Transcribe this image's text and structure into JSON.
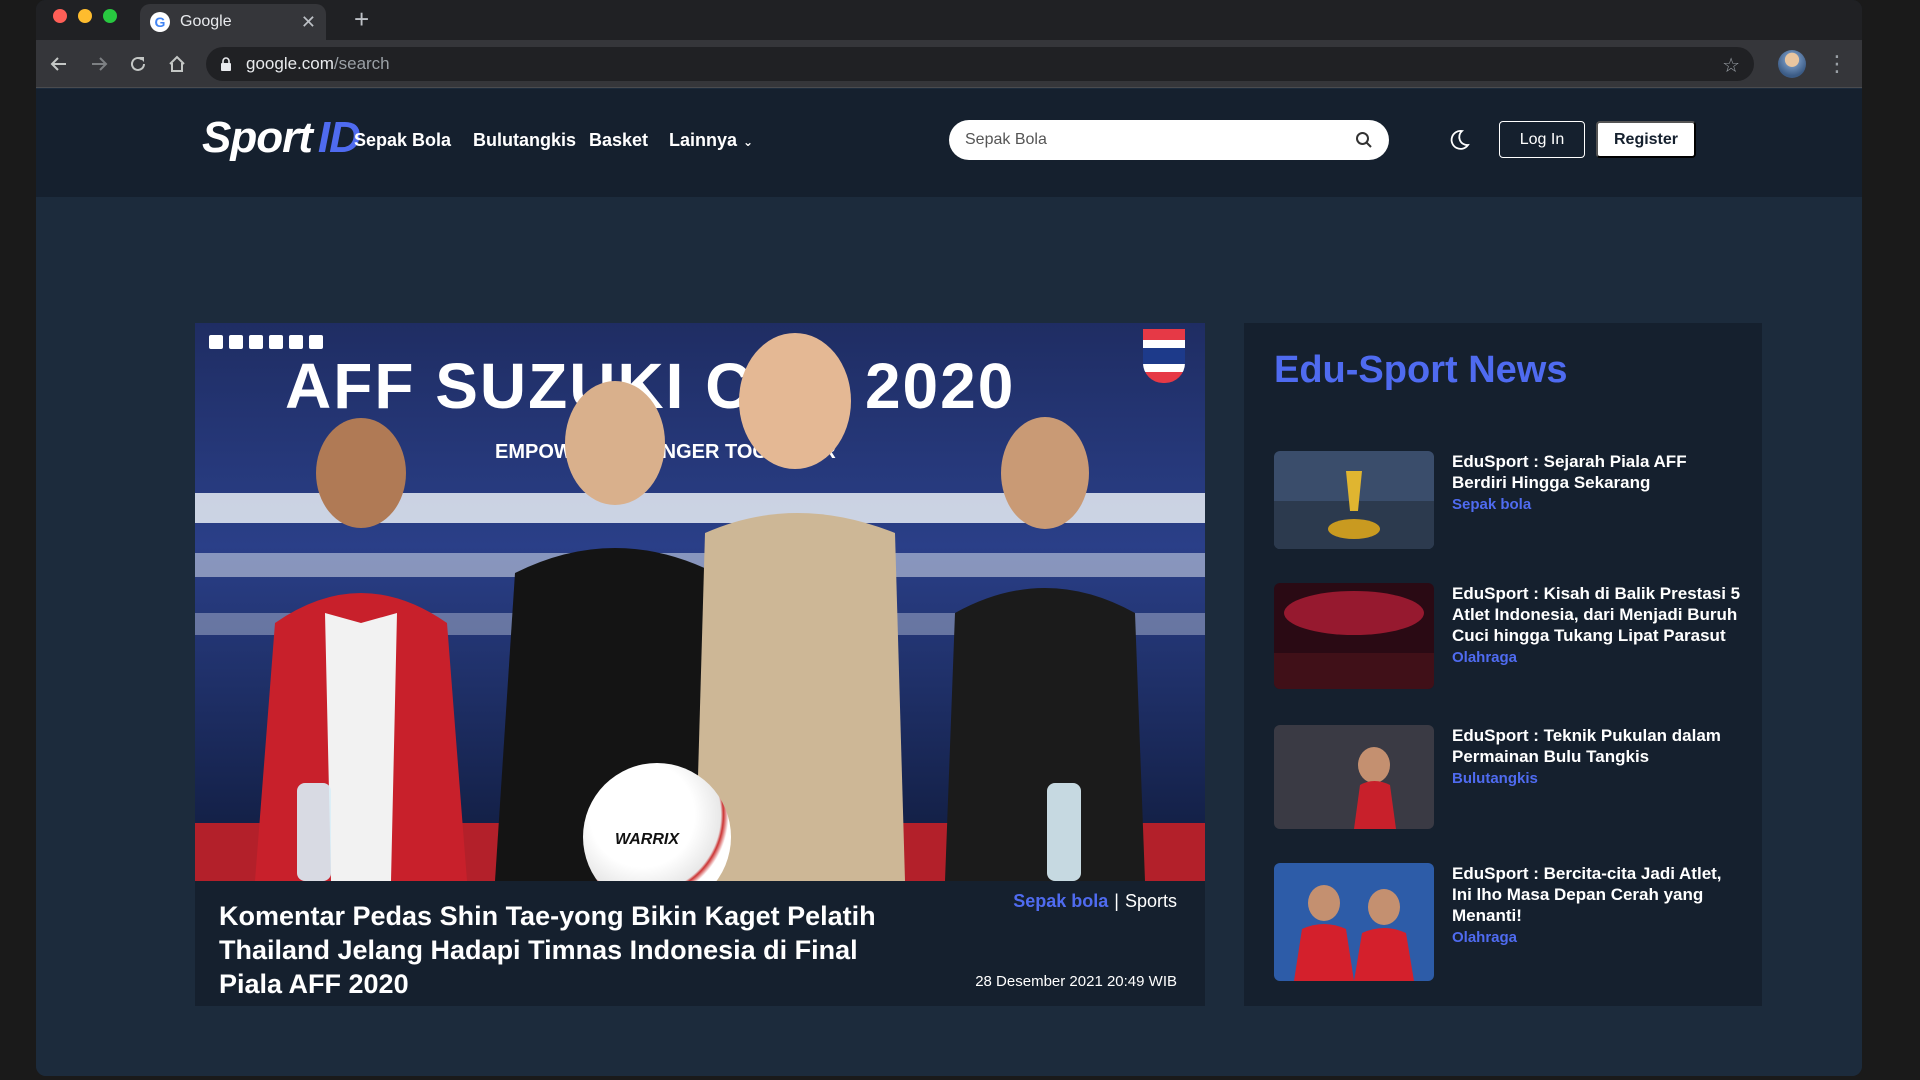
{
  "browser": {
    "tab_title": "Google",
    "url_host": "google.com",
    "url_path": "/search"
  },
  "site": {
    "logo_sport": "Sport",
    "logo_id": "ID",
    "nav": [
      "Sepak Bola",
      "Bulutangkis",
      "Basket",
      "Lainnya"
    ],
    "search_value": "Sepak Bola",
    "login_label": "Log In",
    "register_label": "Register",
    "accent_color": "#4f6bf0"
  },
  "hero": {
    "banner_text": "AFF SUZUKI CUP 2020",
    "tagline": "EMPOWER  STRONGER  TOGETHER",
    "ball_brand": "WARRIX",
    "title": "Komentar Pedas Shin Tae-yong Bikin Kaget Pelatih Thailand Jelang Hadapi Timnas Indonesia di Final Piala AFF 2020",
    "category": "Sepak bola",
    "tag": "Sports",
    "date": "28 Desember 2021 20:49 WIB"
  },
  "sidebar": {
    "title": "Edu-Sport News",
    "items": [
      {
        "title": "EduSport : Sejarah Piala AFF Berdiri Hingga Sekarang",
        "category": "Sepak bola"
      },
      {
        "title": "EduSport : Kisah di Balik Prestasi 5 Atlet Indonesia, dari Menjadi Buruh Cuci hingga Tukang Lipat Parasut",
        "category": "Olahraga"
      },
      {
        "title": "EduSport : Teknik Pukulan dalam Permainan Bulu Tangkis",
        "category": "Bulutangkis"
      },
      {
        "title": "EduSport : Bercita-cita Jadi Atlet, Ini lho Masa Depan Cerah yang Menanti!",
        "category": "Olahraga"
      }
    ]
  }
}
